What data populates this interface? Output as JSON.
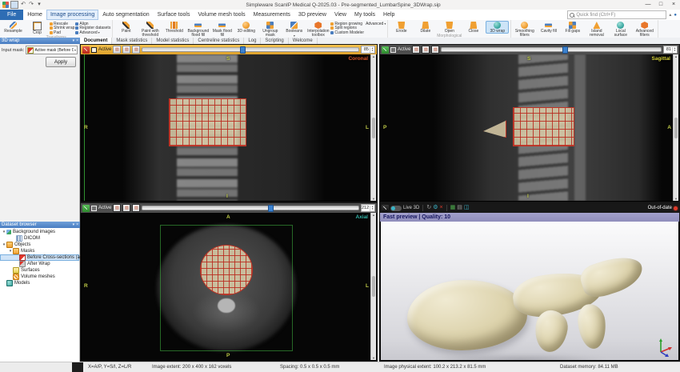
{
  "window": {
    "title": "Simpleware ScanIP Medical Q-2025.03 - Pre-segmented_LumbarSpine_3DWrap.sip",
    "minimize": "—",
    "maximize": "□",
    "close": "×"
  },
  "menubar": {
    "file": "File",
    "tabs": [
      "Home",
      "Image processing",
      "Auto segmentation",
      "Surface tools",
      "Volume mesh tools",
      "Measurements",
      "3D preview",
      "View",
      "My tools",
      "Help"
    ],
    "quick_find": "Quick find (Ctrl+F)"
  },
  "ribbon": {
    "transforms": {
      "label": "Transforms",
      "big": [
        "Resample",
        "Crop"
      ],
      "small": [
        "Rescale",
        "Shrink wrap",
        "Pad",
        "Align",
        "Register datasets",
        "Advanced"
      ]
    },
    "segmentation": {
      "label": "Segmentation",
      "big": [
        "Paint",
        "Paint with threshold",
        "Threshold",
        "Background flood fill",
        "Mask flood fill",
        "3D editing",
        "Ungroup mask",
        "Booleans",
        "Interpolation toolbox"
      ],
      "small": [
        "Region growing",
        "Advanced",
        "Split regions",
        "Custom Modeler"
      ]
    },
    "morphological": {
      "label": "Morphological",
      "big": [
        "Erode",
        "Dilate",
        "Open",
        "Close",
        "3D wrap"
      ]
    },
    "additional": {
      "label": "Additional",
      "big": [
        "Smoothing filters",
        "Cavity fill",
        "Fill gaps",
        "Island removal",
        "Local surface correction",
        "Advanced filters"
      ]
    }
  },
  "doc_tabs": [
    "Document",
    "Mask statistics",
    "Model statistics",
    "Centreline statistics",
    "Log",
    "Scripting",
    "Welcome"
  ],
  "wrap_panel": {
    "title": "3D wrap",
    "input_label": "Input mask:",
    "input_value": "Active mask (Before Cross-sectio...",
    "apply": "Apply"
  },
  "dataset_browser": {
    "title": "Dataset browser",
    "items": [
      {
        "label": "Background images"
      },
      {
        "label": "DICOM"
      },
      {
        "label": "Objects"
      },
      {
        "label": "Masks"
      },
      {
        "label": "Before Cross-sections (active)"
      },
      {
        "label": "After Wrap"
      },
      {
        "label": "Surfaces"
      },
      {
        "label": "Volume meshes"
      },
      {
        "label": "Models"
      }
    ]
  },
  "viewports": {
    "coronal": {
      "name": "Coronal",
      "active": "Active",
      "slice": "85",
      "top": "S",
      "bottom": "I",
      "left": "R",
      "right": "L"
    },
    "sagittal": {
      "name": "Sagittal",
      "active": "Active",
      "slice": "81",
      "top": "S",
      "bottom": "I",
      "left": "P",
      "right": "A"
    },
    "axial": {
      "name": "Axial",
      "active": "Active",
      "slice": "212",
      "top": "A",
      "bottom": "P",
      "left": "R",
      "right": "L"
    },
    "view3d": {
      "live": "Live 3D",
      "status": "Out-of-date",
      "banner": "Fast preview | Quality: 10"
    }
  },
  "status_bar": {
    "axes": "X=A/P, Y=S/I, Z=L/R",
    "extent": "Image extent: 200 x 400 x 162 voxels",
    "spacing": "Spacing: 0.5 x 0.5 x 0.5 mm",
    "physical": "Image physical extent: 100.2 x 213.2 x 81.5 mm",
    "memory": "Dataset memory: 84.11 MB"
  },
  "colors": {
    "accent_blue": "#2e6db4",
    "mask_tan": "#dbcda8",
    "grid_red": "#c03426",
    "coronal_label": "#e0592a",
    "sagittal_label": "#d6d23a",
    "axial_label": "#35b5a9",
    "active_toolbar": "#e9b83c",
    "out_of_date_dot": "#e03a2a"
  }
}
